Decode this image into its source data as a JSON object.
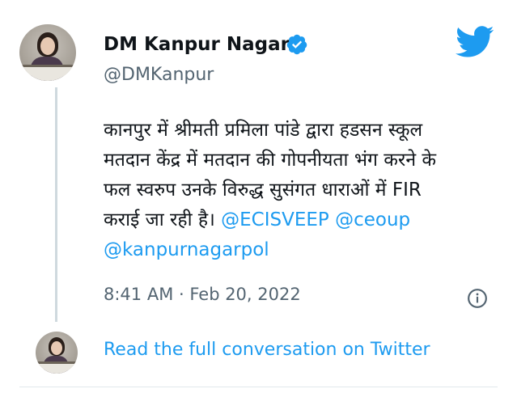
{
  "author": {
    "display_name": "DM Kanpur Nagar",
    "handle": "@DMKanpur",
    "verified": true
  },
  "tweet": {
    "text_lines": [
      "कानपुर में श्रीमती प्रमिला पांडे द्वारा हडसन स्कूल",
      "मतदान केंद्र में मतदान की गोपनीयता भंग करने के",
      "फल स्वरुप उनके विरुद्ध सुसंगत धाराओं में FIR",
      "कराई जा रही है।"
    ],
    "mentions": [
      "@ECISVEEP",
      "@ceoup",
      "@kanpurnagarpol"
    ],
    "timestamp": "8:41 AM · Feb 20, 2022"
  },
  "footer": {
    "read_conversation_label": "Read the full conversation on Twitter"
  },
  "icons": {
    "brand": "twitter-bird-icon",
    "verified": "verified-badge-icon",
    "info": "info-icon"
  },
  "colors": {
    "accent": "#1d9bf0",
    "secondary_text": "#536471",
    "primary_text": "#0f1419"
  }
}
